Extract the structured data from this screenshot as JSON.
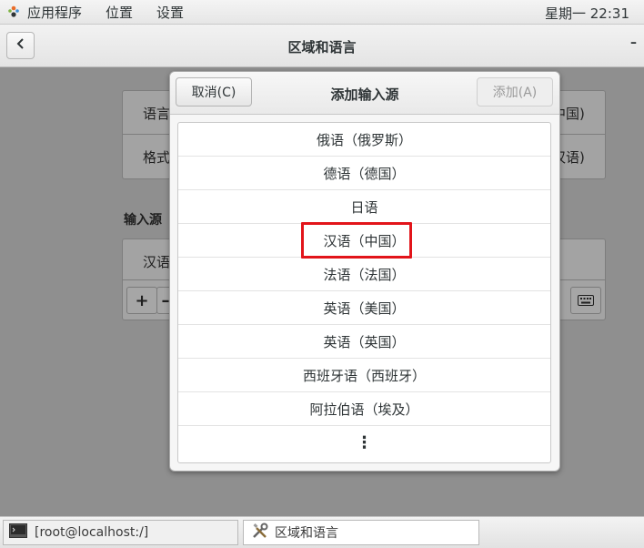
{
  "topbar": {
    "apps_label": "应用程序",
    "places_label": "位置",
    "settings_label": "设置",
    "clock": "星期一 22:31"
  },
  "window": {
    "title": "区域和语言",
    "minimize_label": "–"
  },
  "background": {
    "language_label": "语言",
    "language_value": "中国)",
    "formats_label": "格式",
    "formats_value": "汉语)",
    "input_sources_heading": "输入源",
    "input_source_item": "汉语",
    "add_button_label": "+",
    "remove_button_label": "–"
  },
  "dialog": {
    "title": "添加输入源",
    "cancel_label": "取消(C)",
    "add_label": "添加(A)",
    "items": [
      "俄语（俄罗斯）",
      "德语（德国）",
      "日语",
      "汉语（中国）",
      "法语（法国）",
      "英语（美国）",
      "英语（英国）",
      "西班牙语（西班牙）",
      "阿拉伯语（埃及）"
    ],
    "more_label": "⋮"
  },
  "taskbar": {
    "terminal_label": "[root@localhost:/]",
    "settings_label": "区域和语言"
  },
  "colors": {
    "highlight": "#e2141a",
    "dim_overlay": "#8f8f8f"
  }
}
